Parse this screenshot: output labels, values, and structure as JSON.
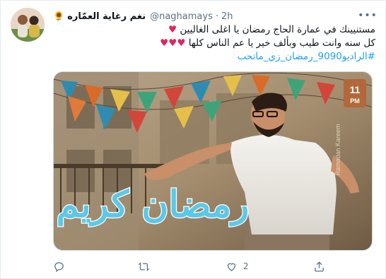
{
  "tweet": {
    "display_name": "نغم رغاية العمّاره",
    "name_emoji": "🌻",
    "handle": "@naghamays",
    "separator": "·",
    "time": "2h",
    "more_icon": "more-dots-icon",
    "text_line1": "مستنيينك في عمارة الحاج رمضان يا اغلى الغاليين",
    "text_line1_hearts": "♥",
    "text_line2": "كل سنه وانت طيب وبألف خير يا عم الناس كلها",
    "text_line2_hearts": "♥♥♥",
    "hashtag": "#الراديو9090_رمضان_زي_ماتحب",
    "media": {
      "badge_time": "11",
      "badge_unit": "PM",
      "calligraphy": "رمضان كريم",
      "vertical_label": "Ramadan Kareem"
    },
    "actions": {
      "reply_icon": "reply-icon",
      "retweet_icon": "retweet-icon",
      "like_icon": "heart-icon",
      "like_count": "2",
      "share_icon": "share-icon"
    },
    "colors": {
      "heart": "#e0245e",
      "hashtag": "#1da1f2",
      "muted": "#5b7083",
      "calligraphy": "#5cc8e8"
    }
  }
}
